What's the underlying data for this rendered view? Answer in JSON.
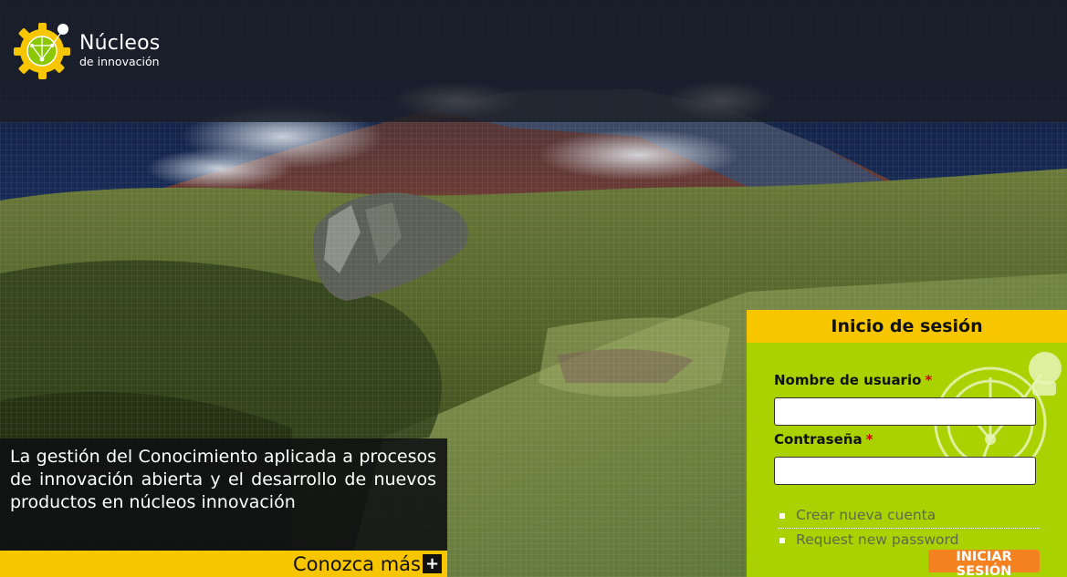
{
  "brand": {
    "name_line1": "Núcleos",
    "name_line2": "de innovación",
    "logo_icon": "gear-network-logo-icon",
    "yellow": "#f7c600",
    "green": "#aad200",
    "orange": "#f58220"
  },
  "hero": {
    "text": "La gestión del Conocimiento aplicada a procesos de innovación abierta y el desarrollo de nuevos productos en núcleos innovación",
    "more_label": "Conozca más",
    "more_icon": "plus-icon"
  },
  "login": {
    "title": "Inicio de sesión",
    "username_label": "Nombre de usuario",
    "password_label": "Contraseña",
    "required_marker": "*",
    "username_value": "",
    "password_value": "",
    "links": [
      "Crear nueva cuenta",
      "Request new password"
    ],
    "submit_label": "INICIAR SESIÓN"
  }
}
